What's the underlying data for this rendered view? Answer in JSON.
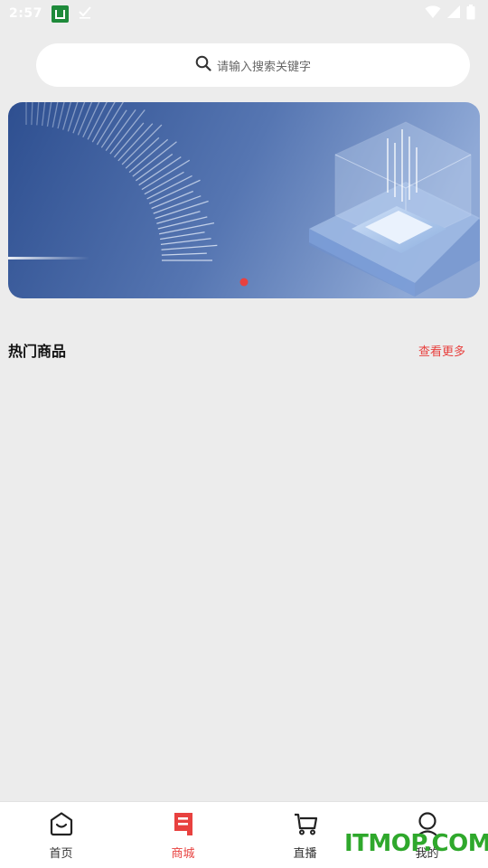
{
  "status_bar": {
    "time": "2:57"
  },
  "search": {
    "placeholder": "请输入搜索关键字",
    "icon": "search-icon"
  },
  "banner": {
    "slide_count": 1,
    "active_slide": 0,
    "accent_color": "#e8413f"
  },
  "section": {
    "title": "热门商品",
    "more_label": "查看更多"
  },
  "bottom_nav": {
    "items": [
      {
        "label": "首页",
        "icon": "home-icon",
        "active": false
      },
      {
        "label": "商城",
        "icon": "mall-icon",
        "active": true
      },
      {
        "label": "直播",
        "icon": "cart-icon",
        "active": false
      },
      {
        "label": "我的",
        "icon": "user-icon",
        "active": false
      }
    ]
  },
  "watermark": {
    "text": "ITMOP.COM"
  },
  "colors": {
    "accent": "#e8413f",
    "background": "#ececec",
    "watermark": "#2fa82c"
  }
}
